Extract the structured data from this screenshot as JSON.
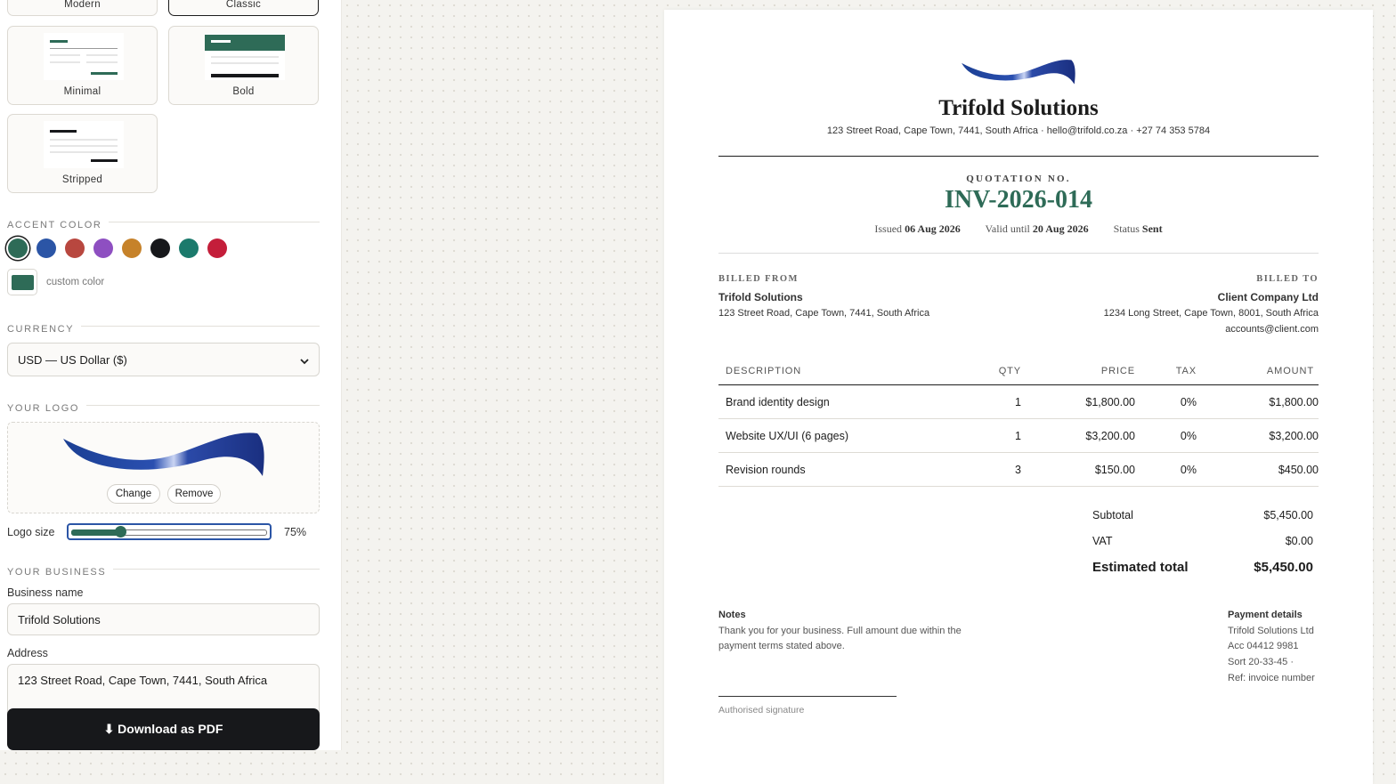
{
  "templates": [
    {
      "label": "Modern"
    },
    {
      "label": "Classic"
    },
    {
      "label": "Minimal"
    },
    {
      "label": "Bold"
    },
    {
      "label": "Stripped"
    }
  ],
  "accent": {
    "heading": "ACCENT COLOR",
    "swatches": [
      "#2e6b57",
      "#2b55a6",
      "#b8473f",
      "#8e4fc1",
      "#c6822a",
      "#17181b",
      "#1b7a6c",
      "#c41e3a"
    ],
    "selected": "#2e6b57",
    "custom_label": "custom color"
  },
  "currency": {
    "heading": "CURRENCY",
    "selected": "USD — US Dollar ($)"
  },
  "logo": {
    "heading": "YOUR LOGO",
    "change": "Change",
    "remove": "Remove",
    "size_label": "Logo size",
    "size_value": "75%",
    "size_fraction": 0.25
  },
  "business": {
    "heading": "YOUR BUSINESS",
    "name_label": "Business name",
    "name_value": "Trifold Solutions",
    "address_label": "Address",
    "address_value": "123 Street Road, Cape Town, 7441, South Africa"
  },
  "download_label": "⬇ Download as PDF",
  "doc": {
    "company": "Trifold Solutions",
    "contact": "123 Street Road, Cape Town, 7441, South Africa · hello@trifold.co.za · +27 74 353 5784",
    "quote_label": "QUOTATION NO.",
    "number": "INV-2026-014",
    "issued_label": "Issued",
    "issued": "06 Aug 2026",
    "valid_label": "Valid until",
    "valid": "20 Aug 2026",
    "status_label": "Status",
    "status": "Sent",
    "from_heading": "BILLED FROM",
    "from_name": "Trifold Solutions",
    "from_address": "123 Street Road, Cape Town, 7441, South Africa",
    "to_heading": "BILLED TO",
    "to_name": "Client Company Ltd",
    "to_address": "1234 Long Street, Cape Town, 8001, South Africa",
    "to_email": "accounts@client.com",
    "columns": [
      "DESCRIPTION",
      "QTY",
      "PRICE",
      "TAX",
      "AMOUNT"
    ],
    "items": [
      {
        "desc": "Brand identity design",
        "qty": "1",
        "price": "$1,800.00",
        "tax": "0%",
        "amount": "$1,800.00"
      },
      {
        "desc": "Website UX/UI (6 pages)",
        "qty": "1",
        "price": "$3,200.00",
        "tax": "0%",
        "amount": "$3,200.00"
      },
      {
        "desc": "Revision rounds",
        "qty": "3",
        "price": "$150.00",
        "tax": "0%",
        "amount": "$450.00"
      }
    ],
    "subtotal_label": "Subtotal",
    "subtotal": "$5,450.00",
    "vat_label": "VAT",
    "vat": "$0.00",
    "total_label": "Estimated total",
    "total": "$5,450.00",
    "notes_heading": "Notes",
    "notes_line1": "Thank you for your business. Full amount due within the",
    "notes_line2": "payment terms stated above.",
    "payment_heading": "Payment details",
    "payment_line1": "Trifold Solutions Ltd",
    "payment_line2": "Acc 04412 9981",
    "payment_line3": "Sort 20-33-45 ·",
    "payment_line4": "Ref: invoice number",
    "signature_label": "Authorised signature"
  }
}
